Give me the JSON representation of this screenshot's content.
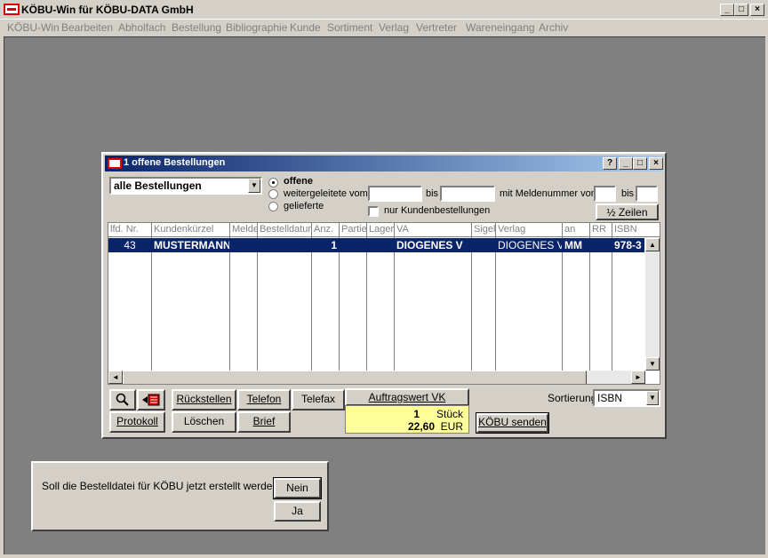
{
  "app": {
    "title": "KÖBU-Win für KÖBU-DATA GmbH",
    "window_buttons": [
      "_",
      "□",
      "×"
    ]
  },
  "menu": [
    "KÖBU-Win",
    "Bearbeiten",
    "Abholfach",
    "Bestellung",
    "Bibliographie",
    "Kunde",
    "Sortiment",
    "Verlag",
    "Vertreter",
    "Wareneingang",
    "Archiv"
  ],
  "orders_window": {
    "title": "1 offene Bestellungen",
    "help": "?",
    "filter_select": "alle Bestellungen",
    "radio": {
      "offene": "offene",
      "weitergeleitete": "weitergeleitete vom",
      "gelieferte": "gelieferte"
    },
    "bis1": "bis",
    "meldenummer": "mit Meldenummer von",
    "bis2": "bis",
    "nur_kunden": "nur Kundenbestellungen",
    "half_rows": "½ Zeilen",
    "columns": [
      "lfd. Nr.",
      "Kundenkürzel",
      "Melde",
      "Bestelldatum",
      "Anz.",
      "Partie",
      "Lager",
      "VA",
      "Sigel",
      "Verlag",
      "an",
      "RR",
      "ISBN"
    ],
    "row": {
      "lfd": "43",
      "kunde": "MUSTERMANN",
      "melde": "",
      "datum": "",
      "anz": "1",
      "partie": "",
      "lager": "",
      "va": "DIOGENES V",
      "sigel": "",
      "verlag": "DIOGENES V",
      "an": "MM",
      "rr": "",
      "isbn": "978-3"
    },
    "buttons": {
      "rueckstellen": "Rückstellen",
      "telefon": "Telefon",
      "telefax": "Telefax",
      "protokoll": "Protokoll",
      "loeschen": "Löschen",
      "brief": "Brief",
      "auftragswert": "Auftragswert VK",
      "senden": "KÖBU senden"
    },
    "totals": {
      "qty": "1",
      "qty_unit": "Stück",
      "amount": "22,60",
      "currency": "EUR"
    },
    "sort_label": "Sortierung",
    "sort_value": "ISBN"
  },
  "dialog": {
    "question": "Soll die Bestelldatei für KÖBU jetzt erstellt werden?",
    "no": "Nein",
    "yes": "Ja"
  }
}
